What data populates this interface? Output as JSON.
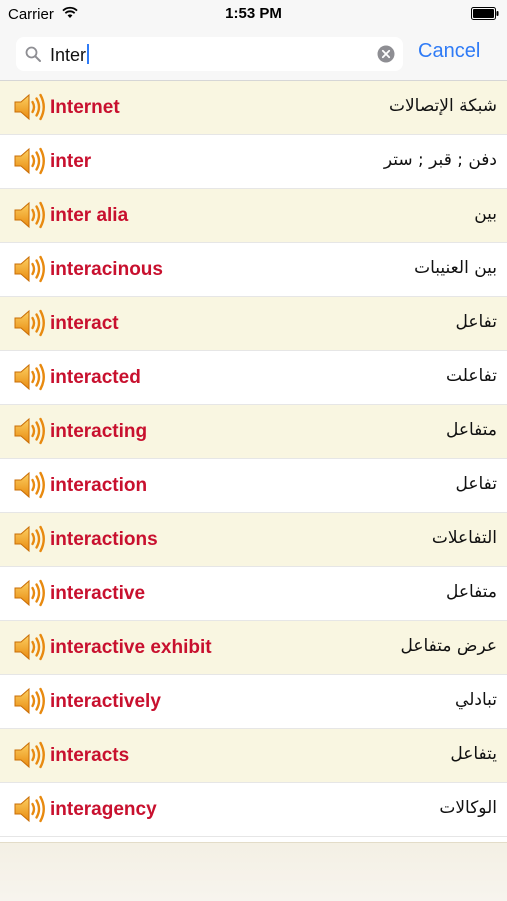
{
  "status_bar": {
    "carrier": "Carrier",
    "time": "1:53 PM"
  },
  "search": {
    "query": "Inter",
    "cancel_label": "Cancel"
  },
  "icons": {
    "speaker": "speaker-icon",
    "search": "magnifier-icon",
    "clear": "clear-icon"
  },
  "colors": {
    "accent": "#2f7bf6",
    "word": "#c8102e",
    "row_alt": "#f9f6e1"
  },
  "results": [
    {
      "word": "Internet",
      "translation": "شبكة الإتصالات"
    },
    {
      "word": "inter",
      "translation": "دفن ; قبر ; ستر"
    },
    {
      "word": "inter alia",
      "translation": "بين"
    },
    {
      "word": "interacinous",
      "translation": "بين العنيبات"
    },
    {
      "word": "interact",
      "translation": "تفاعل"
    },
    {
      "word": "interacted",
      "translation": "تفاعلت"
    },
    {
      "word": "interacting",
      "translation": "متفاعل"
    },
    {
      "word": "interaction",
      "translation": "تفاعل"
    },
    {
      "word": "interactions",
      "translation": "التفاعلات"
    },
    {
      "word": "interactive",
      "translation": "متفاعل"
    },
    {
      "word": "interactive exhibit",
      "translation": "عرض متفاعل"
    },
    {
      "word": "interactively",
      "translation": "تبادلي"
    },
    {
      "word": "interacts",
      "translation": "يتفاعل"
    },
    {
      "word": "interagency",
      "translation": "الوكالات"
    }
  ]
}
